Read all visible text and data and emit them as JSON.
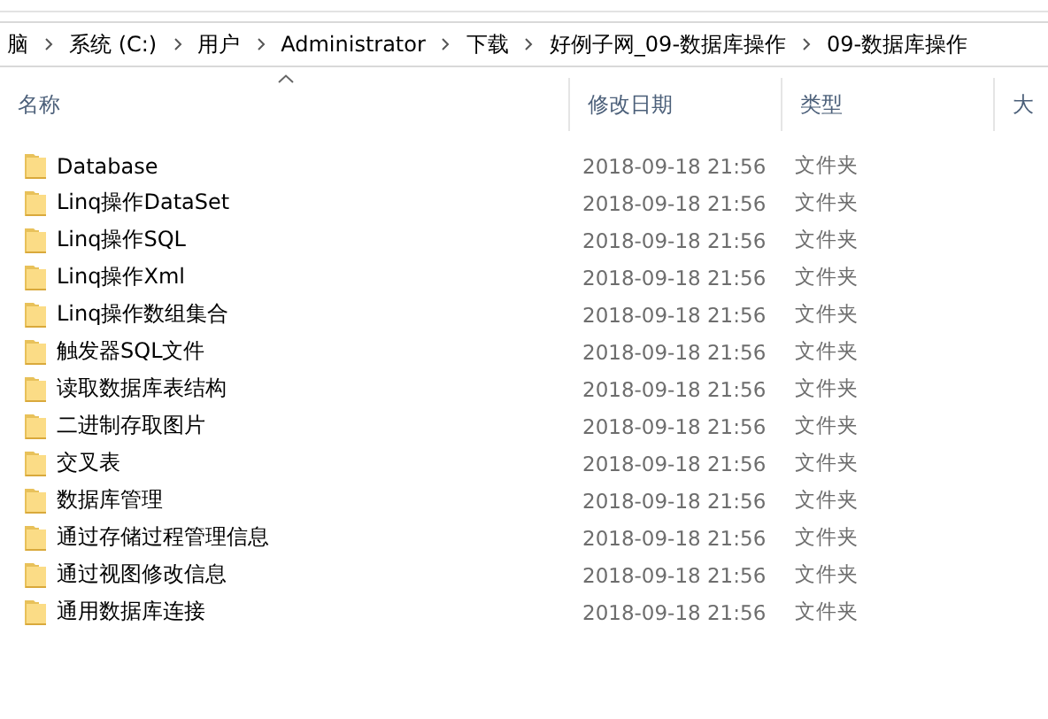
{
  "breadcrumb": [
    "脑",
    "系统 (C:)",
    "用户",
    "Administrator",
    "下载",
    "好例子网_09-数据库操作",
    "09-数据库操作"
  ],
  "columns": [
    {
      "label": "名称",
      "sorted": true
    },
    {
      "label": "修改日期",
      "sorted": false
    },
    {
      "label": "类型",
      "sorted": false
    },
    {
      "label": "大",
      "sorted": false
    }
  ],
  "rows": [
    {
      "name": "Database",
      "modified": "2018-09-18 21:56",
      "type": "文件夹"
    },
    {
      "name": "Linq操作DataSet",
      "modified": "2018-09-18 21:56",
      "type": "文件夹"
    },
    {
      "name": "Linq操作SQL",
      "modified": "2018-09-18 21:56",
      "type": "文件夹"
    },
    {
      "name": "Linq操作Xml",
      "modified": "2018-09-18 21:56",
      "type": "文件夹"
    },
    {
      "name": "Linq操作数组集合",
      "modified": "2018-09-18 21:56",
      "type": "文件夹"
    },
    {
      "name": "触发器SQL文件",
      "modified": "2018-09-18 21:56",
      "type": "文件夹"
    },
    {
      "name": "读取数据库表结构",
      "modified": "2018-09-18 21:56",
      "type": "文件夹"
    },
    {
      "name": "二进制存取图片",
      "modified": "2018-09-18 21:56",
      "type": "文件夹"
    },
    {
      "name": "交叉表",
      "modified": "2018-09-18 21:56",
      "type": "文件夹"
    },
    {
      "name": "数据库管理",
      "modified": "2018-09-18 21:56",
      "type": "文件夹"
    },
    {
      "name": "通过存储过程管理信息",
      "modified": "2018-09-18 21:56",
      "type": "文件夹"
    },
    {
      "name": "通过视图修改信息",
      "modified": "2018-09-18 21:56",
      "type": "文件夹"
    },
    {
      "name": "通用数据库连接",
      "modified": "2018-09-18 21:56",
      "type": "文件夹"
    }
  ]
}
